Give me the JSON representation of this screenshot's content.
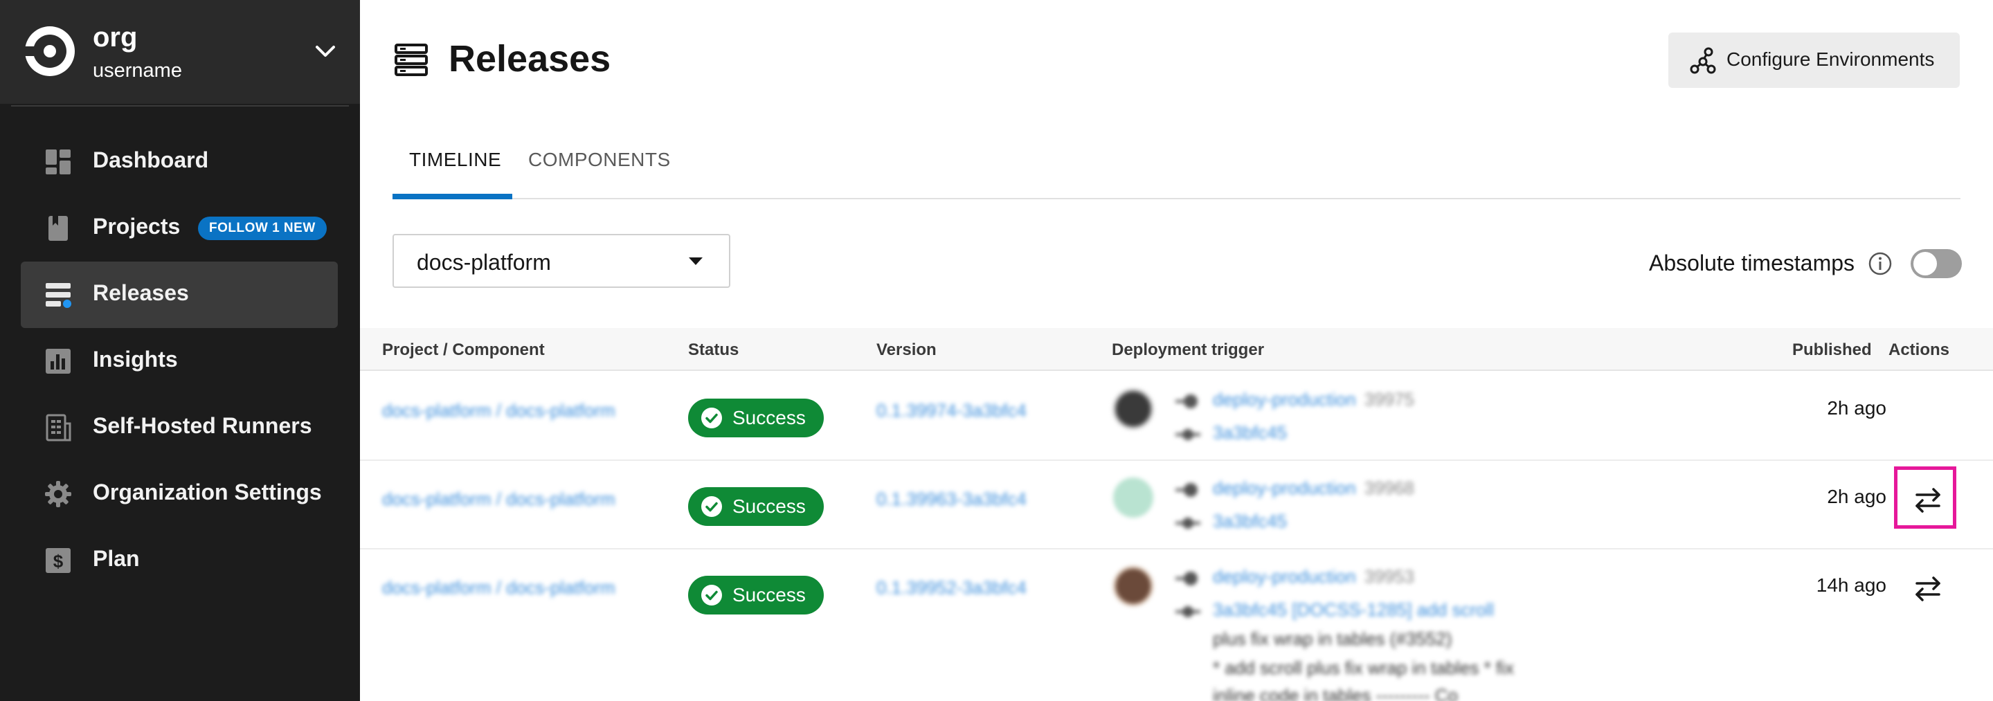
{
  "org": {
    "name": "org",
    "username": "username"
  },
  "sidebar": {
    "items": [
      {
        "label": "Dashboard",
        "icon": "dashboard-icon"
      },
      {
        "label": "Projects",
        "icon": "book-icon",
        "badge": "FOLLOW 1 NEW"
      },
      {
        "label": "Releases",
        "icon": "releases-icon",
        "active": true
      },
      {
        "label": "Insights",
        "icon": "bar-chart-icon"
      },
      {
        "label": "Self-Hosted Runners",
        "icon": "server-icon"
      },
      {
        "label": "Organization Settings",
        "icon": "gear-icon"
      },
      {
        "label": "Plan",
        "icon": "dollar-icon"
      }
    ]
  },
  "header": {
    "title": "Releases",
    "configure_label": "Configure Environments"
  },
  "tabs": [
    {
      "label": "TIMELINE",
      "active": true
    },
    {
      "label": "COMPONENTS",
      "active": false
    }
  ],
  "filter": {
    "selected": "docs-platform"
  },
  "timestamps": {
    "label": "Absolute timestamps",
    "enabled": false
  },
  "table": {
    "columns": {
      "project": "Project / Component",
      "status": "Status",
      "version": "Version",
      "trigger": "Deployment trigger",
      "published": "Published",
      "actions": "Actions"
    },
    "rows": [
      {
        "project": "docs-platform / docs-platform",
        "status": "Success",
        "version": "0.1.39974-3a3bfc4",
        "trigger_job": "deploy-production",
        "trigger_num": "39975",
        "trigger_commit": "3a3bfc45",
        "published": "2h ago"
      },
      {
        "project": "docs-platform / docs-platform",
        "status": "Success",
        "version": "0.1.39963-3a3bfc4",
        "trigger_job": "deploy-production",
        "trigger_num": "39968",
        "trigger_commit": "3a3bfc45",
        "published": "2h ago"
      },
      {
        "project": "docs-platform / docs-platform",
        "status": "Success",
        "version": "0.1.39952-3a3bfc4",
        "trigger_job": "deploy-production",
        "trigger_num": "39953",
        "trigger_commit": "3a3bfc45 [DOCSS-1285] add scroll",
        "trigger_msg_1": "plus fix wrap in tables (#3552)",
        "trigger_msg_2": "* add scroll plus fix wrap in tables * fix",
        "trigger_msg_3": "inline code in tables --------- Co",
        "published": "14h ago"
      }
    ]
  },
  "colors": {
    "accent": "#0a73c4",
    "success": "#0f8a36",
    "highlight": "#e6189a",
    "sidebar": "#1c1c1c"
  }
}
